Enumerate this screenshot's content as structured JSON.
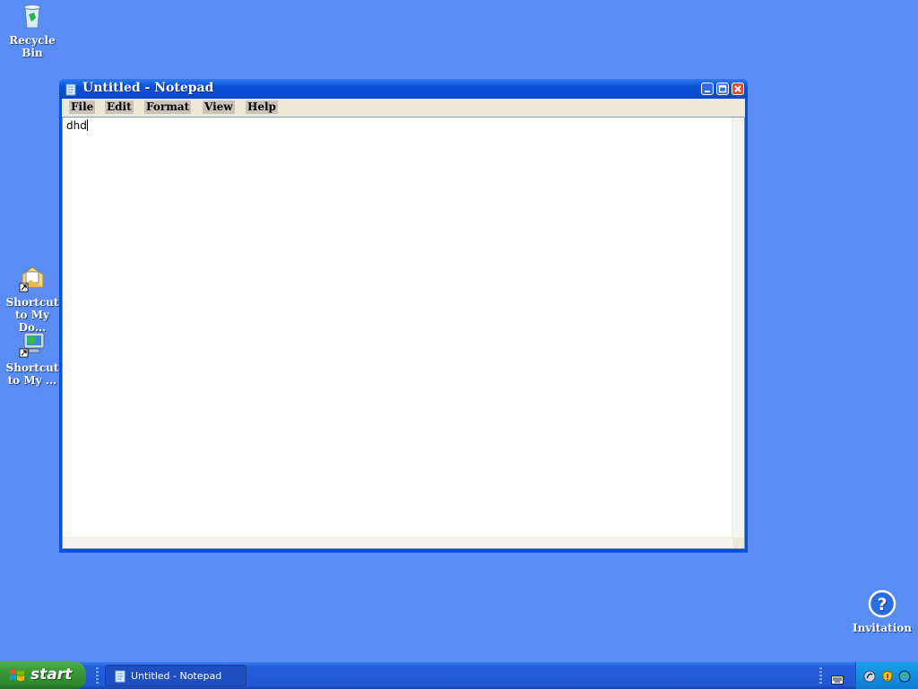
{
  "desktop": {
    "icons": [
      {
        "name": "recycle-bin",
        "label": "Recycle\nBin",
        "icon": "recycle-bin-icon"
      },
      {
        "name": "shortcut-my-documents",
        "label": "Shortcut\nto My Do...",
        "icon": "documents-shortcut-icon"
      },
      {
        "name": "shortcut-my-computer",
        "label": "Shortcut\nto My ...",
        "icon": "computer-shortcut-icon"
      },
      {
        "name": "invitation",
        "label": "Invitation",
        "icon": "help-icon"
      }
    ]
  },
  "window": {
    "title": "Untitled - Notepad",
    "menu": [
      "File",
      "Edit",
      "Format",
      "View",
      "Help"
    ],
    "content": "dhd"
  },
  "taskbar": {
    "start_label": "start",
    "task_label": "Untitled - Notepad"
  },
  "colors": {
    "desktop": "#5a8cf5",
    "titlebar": "#0a50d8",
    "close_button": "#e0502e",
    "start_button": "#3a9a3a",
    "taskbar": "#245edc"
  }
}
